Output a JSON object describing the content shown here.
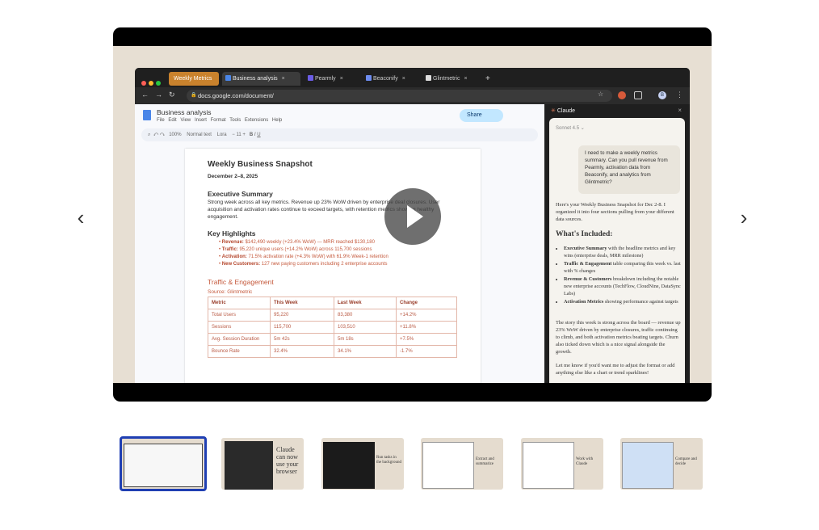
{
  "player": {
    "browser": {
      "tabs": [
        {
          "label": "Weekly Metrics",
          "color": "#e8a23a"
        },
        {
          "label": "Business analysis",
          "active": true
        },
        {
          "label": "Pearmly"
        },
        {
          "label": "Beaconify"
        },
        {
          "label": "Glintmetric"
        }
      ],
      "url": "docs.google.com/document/",
      "profile_initial": "B"
    },
    "doc": {
      "title": "Business analysis",
      "menu": [
        "File",
        "Edit",
        "View",
        "Insert",
        "Format",
        "Tools",
        "Extensions",
        "Help"
      ],
      "share_label": "Share",
      "toolbar": {
        "zoom": "100%",
        "style": "Normal text",
        "font": "Lora",
        "size": "11"
      },
      "heading": "Weekly Business Snapshot",
      "date": "December 2–8, 2025",
      "exec_heading": "Executive Summary",
      "exec_text_1": "Strong week across all key metrics. Revenue up 23% WoW driven by enterprise deal closures. User",
      "exec_text_2": "acquisition and activation rates continue to exceed targets, with retention metrics showing healthy",
      "exec_text_3": "engagement.",
      "highlights_heading": "Key Highlights",
      "highlights": [
        {
          "label": "Revenue:",
          "text": "$142,490 weekly (+23.4% WoW) — MRR reached $130,180"
        },
        {
          "label": "Traffic:",
          "text": "95,220 unique users (+14.2% WoW) across 115,700 sessions"
        },
        {
          "label": "Activation:",
          "text": "71.5% activation rate (+4.3% WoW) with 61.9% Week-1 retention"
        },
        {
          "label": "New Customers:",
          "text": "127 new paying customers including 2 enterprise accounts"
        }
      ],
      "traffic_heading": "Traffic & Engagement",
      "source": "Source: Glintmetric",
      "table": {
        "headers": [
          "Metric",
          "This Week",
          "Last Week",
          "Change"
        ],
        "rows": [
          [
            "Total Users",
            "95,220",
            "83,380",
            "+14.2%"
          ],
          [
            "Sessions",
            "115,700",
            "103,510",
            "+11.8%"
          ],
          [
            "Avg. Session Duration",
            "5m 42s",
            "5m 18s",
            "+7.5%"
          ],
          [
            "Bounce Rate",
            "32.4%",
            "34.1%",
            "-1.7%"
          ]
        ]
      }
    },
    "sidebar": {
      "title": "Claude",
      "model": "Sonnet 4.5",
      "user_message": "I need to make a weekly metrics summary. Can you pull revenue from Pearmly, activation data from Beaconify, and analytics from Glintmetric?",
      "reply_intro": "Here's your Weekly Business Snapshot for Dec 2-8. I organized it into four sections pulling from your different data sources.",
      "included_heading": "What's Included:",
      "included": [
        {
          "label": "Executive Summary",
          "text": "with the headline metrics and key wins (enterprise deals, MRR milestone)"
        },
        {
          "label": "Traffic & Engagement",
          "text": "table comparing this week vs. last with % changes"
        },
        {
          "label": "Revenue & Customers",
          "text": "breakdown including the notable new enterprise accounts (TechFlow, CloudNine, DataSync Labs)"
        },
        {
          "label": "Activation Metrics",
          "text": "showing performance against targets"
        }
      ],
      "reply_story": "The story this week is strong across the board — revenue up 23% WoW driven by enterprise closures, traffic continuing to climb, and both activation metrics beating targets. Churn also ticked down which is a nice signal alongside the growth.",
      "reply_close": "Let me know if you'd want me to adjust the format or add anything else like a chart or trend sparklines!"
    }
  },
  "carousel": {
    "prev_label": "‹",
    "next_label": "›",
    "thumbnails": [
      {
        "caption": ""
      },
      {
        "caption": "Claude can now use your browser"
      },
      {
        "caption": "Run tasks in the background"
      },
      {
        "caption": "Extract and summarize"
      },
      {
        "caption": "Work with Claude"
      },
      {
        "caption": "Compare and decide"
      }
    ]
  }
}
